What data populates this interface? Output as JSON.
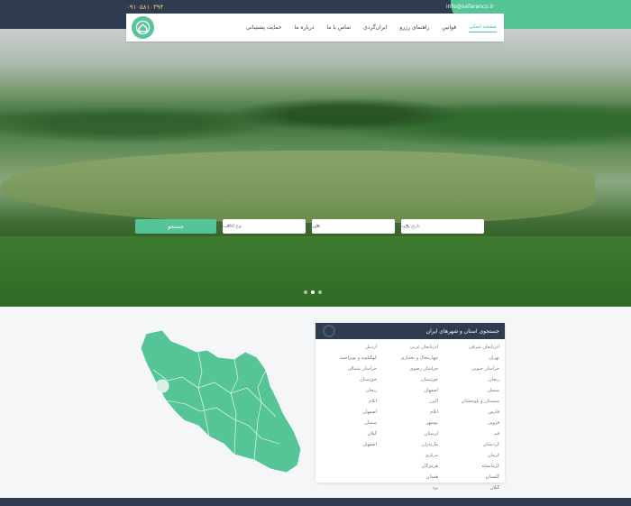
{
  "topbar": {
    "phone": "۰۹۱۰۵۸۱۰۳۹۴",
    "email": "info@safaranco.ir"
  },
  "nav": {
    "items": [
      {
        "label": "صفحه اصلی",
        "active": true
      },
      {
        "label": "قوانین"
      },
      {
        "label": "راهنمای رزرو"
      },
      {
        "label": "ایران‌گردی"
      },
      {
        "label": "تماس با ما"
      },
      {
        "label": "درباره ما"
      },
      {
        "label": "حمایت پشتیبانی"
      }
    ]
  },
  "hero": {
    "search_button": "جستجو",
    "selects": [
      {
        "label": "نوع اقامت"
      },
      {
        "label": "شهر"
      },
      {
        "label": "تاریخ ورود"
      }
    ],
    "slides": 3,
    "active_slide": 2
  },
  "cities_card": {
    "title": "جستجوی استان و شهرهای ایران",
    "columns": [
      [
        "آذربایجان شرقی",
        "تهران",
        "خراسان جنوبی",
        "زنجان",
        "سمنان",
        "سیستان و بلوچستان",
        "فارس",
        "قزوین",
        "قم",
        "کردستان",
        "کرمان",
        "کرمانشاه",
        "گلستان",
        "گیلان"
      ],
      [
        "آذربایجان غربی",
        "چهارمحال و بختیاری",
        "خراسان رضوی",
        "خوزستان",
        "اصفهان",
        "البرز",
        "ایلام",
        "بوشهر",
        "لرستان",
        "مازندران",
        "مرکزی",
        "هرمزگان",
        "همدان",
        "یزد"
      ],
      [
        "اردبیل",
        "کهگیلویه و بویراحمد",
        "خراسان شمالی",
        "خوزستان",
        "زنجان",
        "ایلام",
        "اصفهان",
        "سمنان",
        "گیلان",
        "اصفهان"
      ]
    ]
  },
  "colors": {
    "brand_green": "#55c497",
    "navy": "#2f3b4f",
    "accent_yellow": "#f1d36b"
  },
  "icons": {
    "logo": "home-icon",
    "chevron": "chevron-down-icon"
  }
}
